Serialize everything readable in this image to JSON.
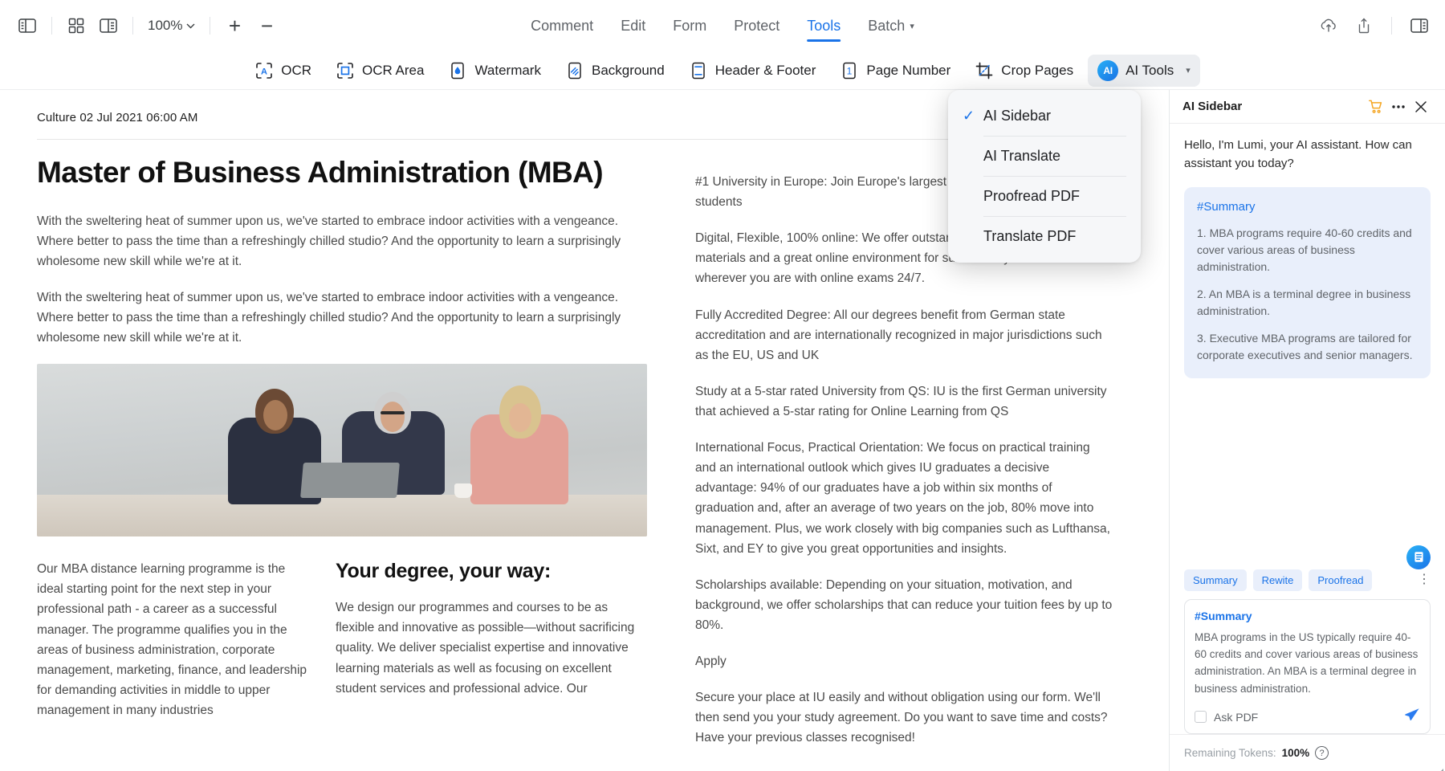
{
  "topbar": {
    "left_icons": [
      {
        "name": "sidebar-toggle-icon",
        "label": "Sidebar"
      },
      {
        "name": "grid-view-icon",
        "label": "Grid View"
      },
      {
        "name": "page-thumbnail-icon",
        "label": "Thumbnails"
      }
    ],
    "zoom_level": "100%",
    "zoom_in": "+",
    "zoom_out": "−",
    "tabs": [
      {
        "label": "Comment",
        "active": false
      },
      {
        "label": "Edit",
        "active": false
      },
      {
        "label": "Form",
        "active": false
      },
      {
        "label": "Protect",
        "active": false
      },
      {
        "label": "Tools",
        "active": true
      },
      {
        "label": "Batch",
        "active": false,
        "caret": true
      }
    ],
    "right_icons": [
      {
        "name": "cloud-upload-icon"
      },
      {
        "name": "share-icon"
      },
      {
        "name": "right-panel-toggle-icon"
      }
    ]
  },
  "toolrow": {
    "tools": [
      {
        "label": "OCR",
        "icon": "ocr-icon"
      },
      {
        "label": "OCR Area",
        "icon": "ocr-area-icon"
      },
      {
        "label": "Watermark",
        "icon": "watermark-icon"
      },
      {
        "label": "Background",
        "icon": "background-icon"
      },
      {
        "label": "Header & Footer",
        "icon": "header-footer-icon"
      },
      {
        "label": "Page Number",
        "icon": "page-number-icon"
      },
      {
        "label": "Crop Pages",
        "icon": "crop-pages-icon"
      },
      {
        "label": "AI Tools",
        "icon": "ai-badge-icon",
        "badge": "AI",
        "active": true,
        "caret": true
      }
    ]
  },
  "menu": {
    "items": [
      {
        "label": "AI Sidebar",
        "checked": true
      },
      {
        "label": "AI Translate",
        "checked": false
      },
      {
        "label": "Proofread PDF",
        "checked": false
      },
      {
        "label": "Translate PDF",
        "checked": false
      }
    ]
  },
  "document": {
    "meta": "Culture 02 Jul 2021 06:00 AM",
    "title": "Master of Business Administration (MBA)",
    "left_paragraphs": [
      "With the sweltering heat of summer upon us, we've started to embrace indoor activities with a vengeance. Where better to pass the time than a refreshingly chilled studio? And the opportunity to learn a surprisingly wholesome new skill while we're at it.",
      "With the sweltering heat of summer upon us, we've started to embrace indoor activities with a vengeance. Where better to pass the time than a refreshingly chilled studio? And the opportunity to learn a surprisingly wholesome new skill while we're at it."
    ],
    "image_alt": "Three business people at a meeting table with a laptop",
    "sub_left_paragraph": "Our MBA distance learning programme is the ideal starting point for the next step in your professional path - a career as a successful manager. The programme qualifies you in the areas of business administration, corporate management, marketing, finance, and leadership for demanding activities in middle to upper management in many industries",
    "sub_right_heading": "Your degree, your way:",
    "sub_right_paragraph": "We design our programmes and courses to be as flexible and innovative as possible—without sacrificing quality. We deliver specialist expertise and innovative learning materials as well as focusing on excellent student services and professional advice. Our",
    "right_paragraphs": [
      "#1 University in Europe: Join Europe's largest private university with 85,000 students",
      "Digital, Flexible, 100% online: We offer outstanding digital learning materials and a great online environment for success in your studies wherever you are with online exams 24/7.",
      "Fully Accredited Degree: All our degrees benefit from German state accreditation and are internationally recognized in major jurisdictions such as the EU, US and UK",
      "Study at a 5-star rated University from QS: IU is the first German university that achieved a 5-star rating for Online Learning from QS",
      "International Focus, Practical Orientation: We focus on practical training and an international outlook which gives IU graduates a decisive advantage: 94% of our graduates have a job within six months of graduation and, after an average of two years on the job, 80% move into management. Plus, we work closely with big companies such as Lufthansa, Sixt, and EY to give you great opportunities and insights.",
      "Scholarships available: Depending on your situation, motivation, and background, we offer scholarships that can reduce your tuition fees by up to 80%.",
      "Apply",
      "Secure your place at IU easily and without obligation using our form. We'll then send you your study agreement. Do you want to save time and costs? Have your previous classes recognised!"
    ]
  },
  "sidebar": {
    "title": "AI Sidebar",
    "header_icons": [
      {
        "name": "cart-icon"
      },
      {
        "name": "more-options-icon"
      },
      {
        "name": "close-icon"
      }
    ],
    "greeting": "Hello, I'm Lumi, your AI assistant. How can assistant you today?",
    "response": {
      "heading": "#Summary",
      "items": [
        "1. MBA programs require 40-60 credits and cover various areas of business administration.",
        "2. An MBA is a terminal degree in business administration.",
        "3. Executive MBA programs are tailored for corporate executives and senior managers."
      ]
    },
    "fab": {
      "name": "document-ai-icon"
    },
    "chips": [
      {
        "label": "Summary"
      },
      {
        "label": "Rewite"
      },
      {
        "label": "Proofread"
      }
    ],
    "chips_more": "⋮",
    "composer": {
      "heading": "#Summary",
      "text": "MBA programs in the US typically require 40-60 credits and cover various areas of business administration. An MBA is a terminal degree in business administration.",
      "checkbox_label": "Ask PDF",
      "send_icon": "send-icon"
    },
    "status": {
      "label": "Remaining Tokens:",
      "value": "100%",
      "help": "?"
    }
  },
  "colors": {
    "accent": "#1a73e8",
    "cart_orange": "#f5a623",
    "bubble_bg": "#e9effb",
    "text_muted": "#5f6368"
  }
}
